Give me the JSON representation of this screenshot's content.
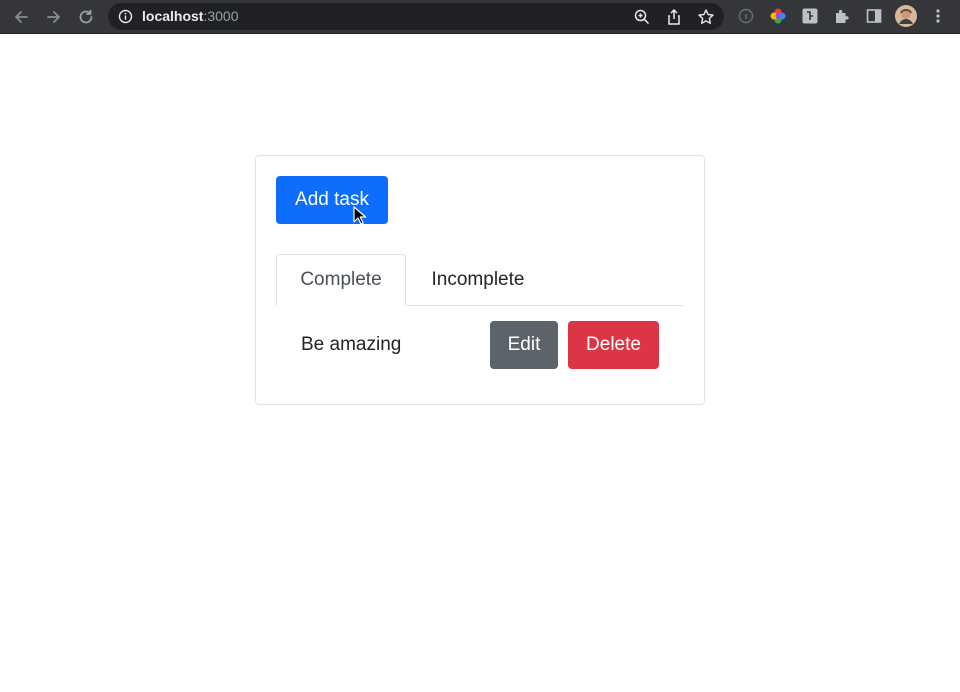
{
  "browser": {
    "url_host": "localhost",
    "url_port": ":3000",
    "icons": {
      "back": "back-arrow-icon",
      "forward": "forward-arrow-icon",
      "reload": "reload-icon",
      "info": "info-icon",
      "zoom": "zoom-icon",
      "share": "share-icon",
      "bookmark": "star-icon",
      "extensions": "puzzle-icon",
      "side_panel": "side-panel-icon",
      "profile": "avatar",
      "menu": "kebab-menu-icon"
    }
  },
  "app": {
    "add_button": "Add task",
    "tabs": [
      {
        "label": "Complete",
        "active": true
      },
      {
        "label": "Incomplete",
        "active": false
      }
    ],
    "tasks": [
      {
        "title": "Be amazing",
        "edit_label": "Edit",
        "delete_label": "Delete"
      }
    ]
  },
  "colors": {
    "primary": "#0d6efd",
    "secondary": "#5c636a",
    "danger": "#dc3545",
    "chrome": "#35363a"
  }
}
